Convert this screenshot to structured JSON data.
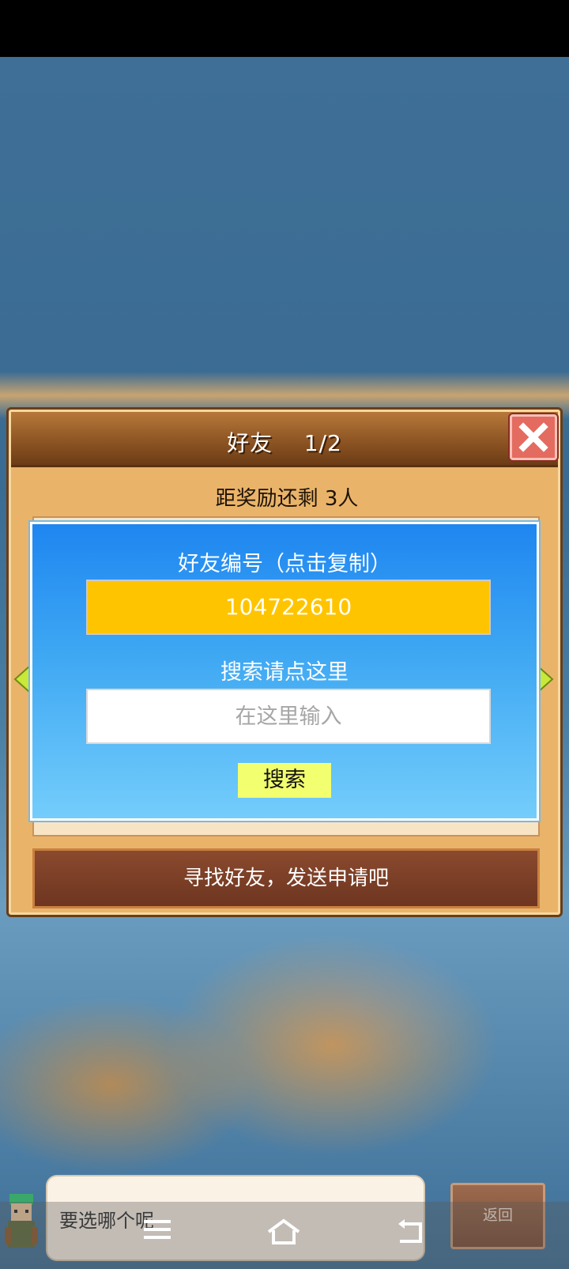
{
  "dialog": {
    "title": "好友",
    "page_indicator": "1/2",
    "reward_text": "距奖励还剩 3人",
    "find_friend_banner": "寻找好友，发送申请吧"
  },
  "popup": {
    "friend_id_label": "好友编号（点击复制）",
    "friend_id_value": "104722610",
    "search_label": "搜索请点这里",
    "search_placeholder": "在这里输入",
    "search_button": "搜索"
  },
  "chat": {
    "message": "要选哪个呢",
    "back_button": "返回"
  },
  "colors": {
    "dialog_frame": "#e9b46a",
    "header": "#8a5222",
    "popup_blue": "#1e86f0",
    "friend_id_box": "#ffc400",
    "search_button": "#f2ff6e",
    "close_button": "#e46b5f"
  },
  "icons": [
    "close-icon",
    "arrow-left-icon",
    "arrow-right-icon",
    "menu-icon",
    "home-icon",
    "back-nav-icon"
  ]
}
